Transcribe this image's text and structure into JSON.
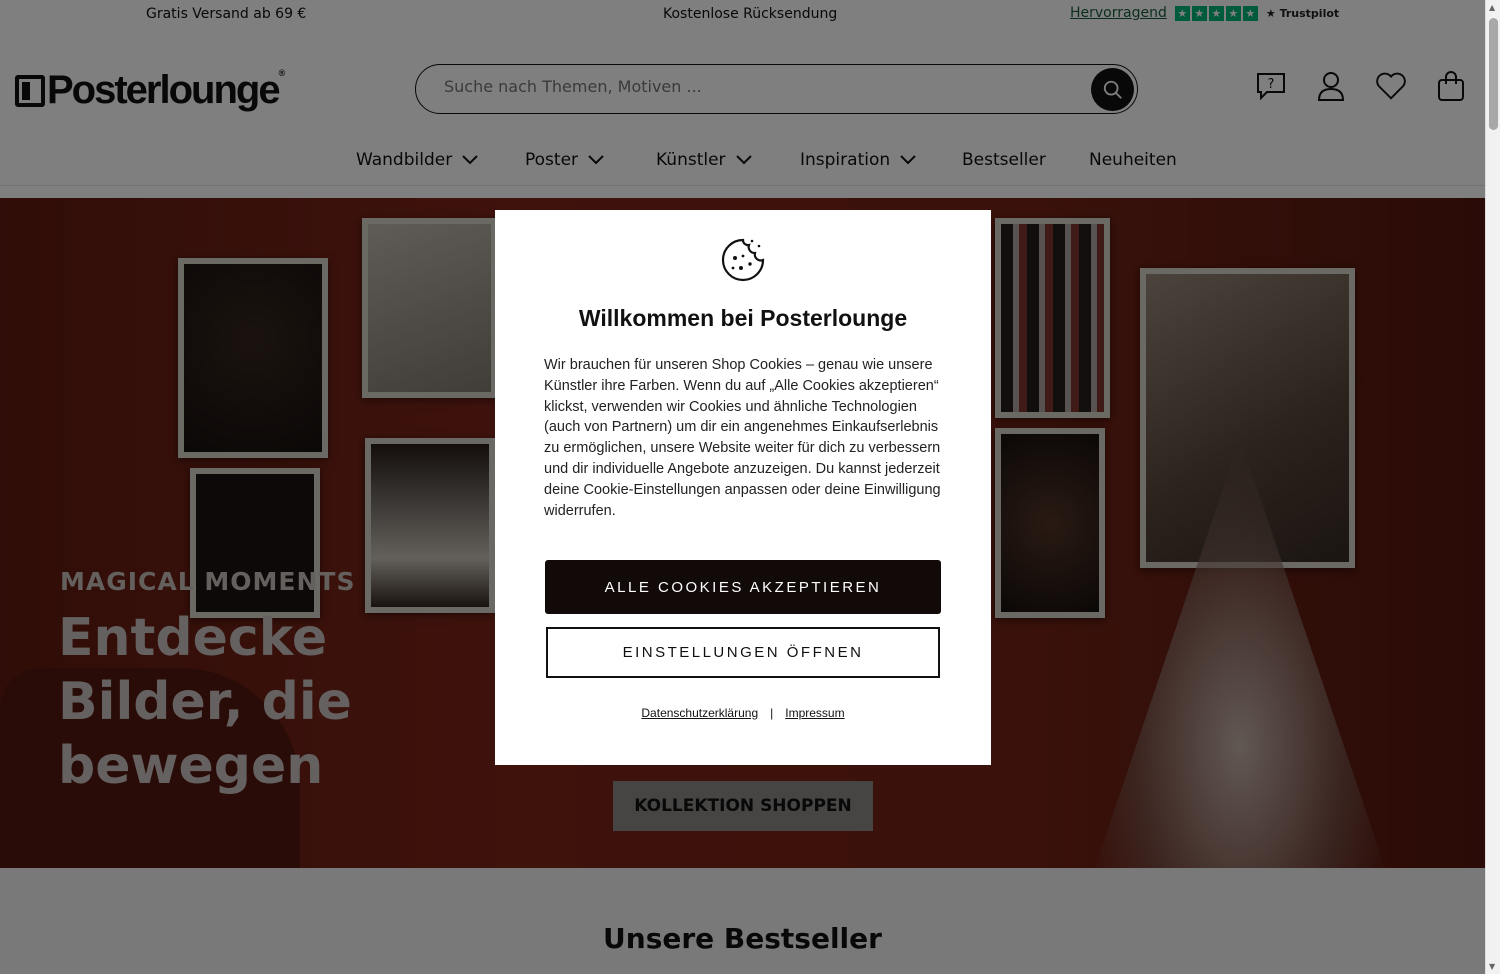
{
  "topbar": {
    "shipping": "Gratis Versand ab 69 €",
    "returns": "Kostenlose Rücksendung",
    "trustpilot_rating": "Hervorragend",
    "trustpilot_brand": "Trustpilot"
  },
  "header": {
    "logo_text": "Posterlounge",
    "logo_reg": "®",
    "search_placeholder": "Suche nach Themen, Motiven ..."
  },
  "nav": {
    "items": [
      {
        "label": "Wandbilder"
      },
      {
        "label": "Poster"
      },
      {
        "label": "Künstler"
      },
      {
        "label": "Inspiration"
      },
      {
        "label": "Bestseller"
      },
      {
        "label": "Neuheiten"
      }
    ]
  },
  "hero": {
    "subtitle": "MAGICAL MOMENTS",
    "title": "Entdecke Bilder, die bewegen",
    "cta": "KOLLEKTION SHOPPEN"
  },
  "section": {
    "bestseller_title": "Unsere Bestseller"
  },
  "cookie_modal": {
    "title": "Willkommen bei Posterlounge",
    "text": "Wir brauchen für unseren Shop Cookies – genau wie unsere Künstler ihre Farben. Wenn du auf „Alle Cookies akzeptieren“ klickst, verwenden wir Cookies und ähnliche Technologien (auch von Partnern) um dir ein angenehmes Einkaufserlebnis zu ermöglichen, unsere Website weiter für dich zu verbessern und dir individuelle Angebote anzuzeigen. Du kannst jederzeit deine Cookie-Einstellungen anpassen oder deine Einwilligung widerrufen.",
    "accept_label": "ALLE COOKIES AKZEPTIEREN",
    "settings_label": "EINSTELLUNGEN ÖFFNEN",
    "privacy_link": "Datenschutzerklärung",
    "separator": "|",
    "imprint_link": "Impressum"
  },
  "colors": {
    "overlay": "rgba(0,0,0,0.5)",
    "accept_bg": "#110a08",
    "trustpilot_green": "#00b67a"
  },
  "icons": [
    "search-icon",
    "help-icon",
    "account-icon",
    "wishlist-icon",
    "cart-icon",
    "chevron-down-icon",
    "cookie-icon",
    "star-icon"
  ]
}
